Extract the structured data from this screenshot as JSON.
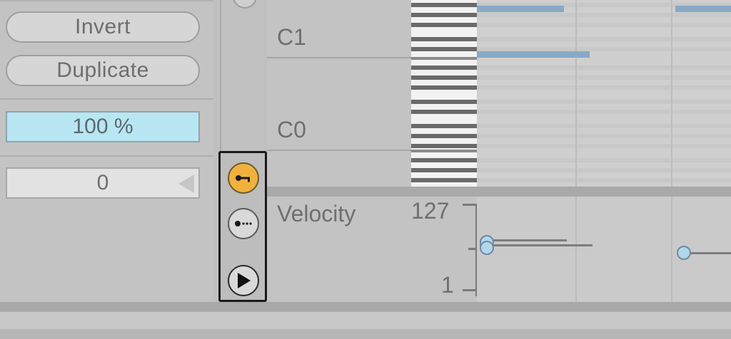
{
  "left_panel": {
    "invert_label": "Invert",
    "duplicate_label": "Duplicate",
    "percent_value": "100 %",
    "offset_value": "0"
  },
  "note_labels": [
    "C1",
    "C0"
  ],
  "velocity": {
    "label": "Velocity",
    "max": "127",
    "min": "1"
  },
  "toggles": [
    {
      "icon": "fold-icon",
      "active": true
    },
    {
      "icon": "scale-icon",
      "active": false
    },
    {
      "icon": "play-icon",
      "active": false
    }
  ],
  "colors": {
    "accent": "#f0b23c",
    "note": "#88a9c6",
    "percent_bg": "#b8e6f2"
  }
}
